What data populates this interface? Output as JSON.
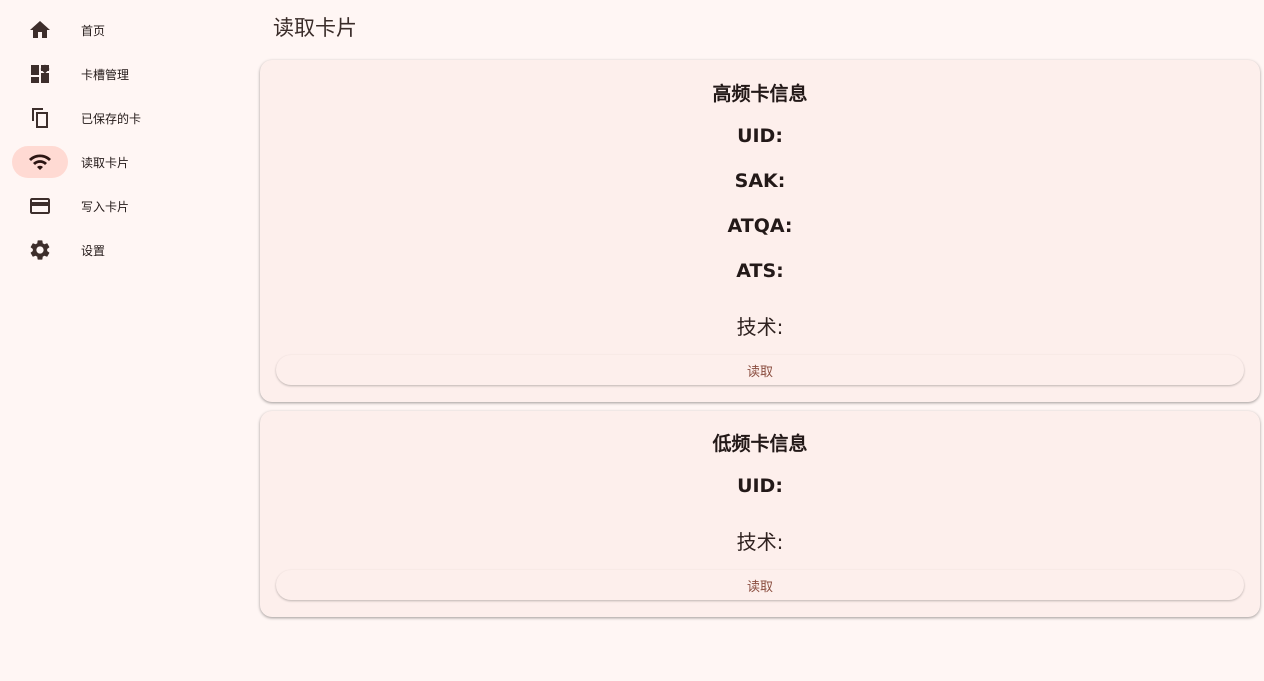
{
  "sidebar": {
    "items": [
      {
        "label": "首页",
        "icon": "home-icon",
        "active": false
      },
      {
        "label": "卡槽管理",
        "icon": "dashboard-icon",
        "active": false
      },
      {
        "label": "已保存的卡",
        "icon": "copy-icon",
        "active": false
      },
      {
        "label": "读取卡片",
        "icon": "wifi-icon",
        "active": true
      },
      {
        "label": "写入卡片",
        "icon": "credit-card-icon",
        "active": false
      },
      {
        "label": "设置",
        "icon": "gear-icon",
        "active": false
      }
    ]
  },
  "main": {
    "title": "读取卡片",
    "hf_card": {
      "title": "高频卡信息",
      "uid_label": "UID:",
      "sak_label": "SAK:",
      "atqa_label": "ATQA:",
      "ats_label": "ATS:",
      "tech_label": "技术:",
      "read_button": "读取"
    },
    "lf_card": {
      "title": "低频卡信息",
      "uid_label": "UID:",
      "tech_label": "技术:",
      "read_button": "读取"
    }
  },
  "colors": {
    "background": "#fff6f4",
    "card": "#fdefec",
    "active_indicator": "#ffdad3",
    "button_text": "#8a4d3f"
  }
}
